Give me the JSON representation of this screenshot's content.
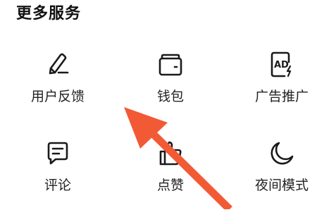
{
  "section": {
    "title": "更多服务"
  },
  "services": [
    {
      "label": "用户反馈",
      "icon": "feedback-pen-icon"
    },
    {
      "label": "钱包",
      "icon": "wallet-icon"
    },
    {
      "label": "广告推广",
      "icon": "ad-promotion-icon"
    },
    {
      "label": "评论",
      "icon": "comment-icon"
    },
    {
      "label": "点赞",
      "icon": "thumbs-up-icon"
    },
    {
      "label": "夜间模式",
      "icon": "moon-icon"
    }
  ],
  "annotation": {
    "arrow_color": "#f25a35",
    "points_to": "用户反馈"
  }
}
